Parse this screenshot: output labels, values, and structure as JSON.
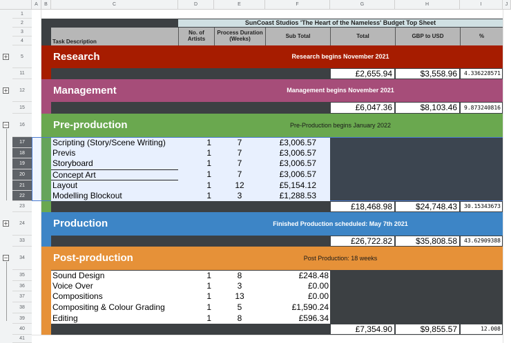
{
  "columns": [
    "A",
    "B",
    "C",
    "D",
    "E",
    "F",
    "G",
    "H",
    "I",
    "J"
  ],
  "sheet": {
    "title": "SunCoast Studios 'The Heart of the Nameless' Budget Top Sheet",
    "headers": {
      "task": "Task Description",
      "artists": "No. of Artists",
      "duration": "Process Duration (Weeks)",
      "subtotal": "Sub Total",
      "total": "Total",
      "gbp_usd": "GBP to USD",
      "pct": "%"
    }
  },
  "row_numbers": {
    "r1": "1",
    "r2": "2",
    "r3": "3",
    "r4": "4",
    "r5": "5",
    "r11": "11",
    "r12": "12",
    "r15": "15",
    "r16": "16",
    "r17": "17",
    "r18": "18",
    "r19": "19",
    "r20": "20",
    "r21": "21",
    "r22": "22",
    "r23": "23",
    "r24": "24",
    "r33": "33",
    "r34": "34",
    "r35": "35",
    "r36": "36",
    "r37": "37",
    "r38": "38",
    "r39": "39",
    "r40": "40",
    "r41": "41"
  },
  "toggles": {
    "plus": "+",
    "minus": "−"
  },
  "colors": {
    "research": "#a61c00",
    "management": "#a64d79",
    "preproduction": "#6aa84f",
    "production": "#3d85c6",
    "postproduction": "#e69138",
    "dark": "#3c4043",
    "light_blue": "#e8f0fe"
  },
  "research": {
    "title": "Research",
    "note": "Research begins November 2021",
    "total": "£2,655.94",
    "usd": "$3,558.96",
    "pct": "4.336228571"
  },
  "management": {
    "title": "Management",
    "note": "Management begins November 2021",
    "total": "£6,047.36",
    "usd": "$8,103.46",
    "pct": "9.873240816"
  },
  "preproduction": {
    "title": "Pre-production",
    "note": "Pre-Production begins January 2022",
    "tasks": [
      {
        "name": "Scripting (Story/Scene Writing)",
        "artists": "1",
        "weeks": "7",
        "subtotal": "£3,006.57"
      },
      {
        "name": "Previs",
        "artists": "1",
        "weeks": "7",
        "subtotal": "£3,006.57"
      },
      {
        "name": "Storyboard",
        "artists": "1",
        "weeks": "7",
        "subtotal": "£3,006.57"
      },
      {
        "name": "Concept Art",
        "artists": "1",
        "weeks": "7",
        "subtotal": "£3,006.57"
      },
      {
        "name": "Layout",
        "artists": "1",
        "weeks": "12",
        "subtotal": "£5,154.12"
      },
      {
        "name": "Modelling Blockout",
        "artists": "1",
        "weeks": "3",
        "subtotal": "£1,288.53"
      }
    ],
    "total": "£18,468.98",
    "usd": "$24,748.43",
    "pct": "30.15343673"
  },
  "production": {
    "title": "Production",
    "note": "Finished Production scheduled: May 7th 2021",
    "total": "£26,722.82",
    "usd": "$35,808.58",
    "pct": "43.62909388"
  },
  "postproduction": {
    "title": "Post-production",
    "note": "Post Production: 18 weeks",
    "tasks": [
      {
        "name": "Sound Design",
        "artists": "1",
        "weeks": "8",
        "subtotal": "£248.48"
      },
      {
        "name": "Voice Over",
        "artists": "1",
        "weeks": "3",
        "subtotal": "£0.00"
      },
      {
        "name": "Compositions",
        "artists": "1",
        "weeks": "13",
        "subtotal": "£0.00"
      },
      {
        "name": "Compositing & Colour Grading",
        "artists": "1",
        "weeks": "5",
        "subtotal": "£1,590.24"
      },
      {
        "name": "Editing",
        "artists": "1",
        "weeks": "8",
        "subtotal": "£596.34"
      }
    ],
    "total": "£7,354.90",
    "usd": "$9,855.57",
    "pct": "12.008"
  }
}
